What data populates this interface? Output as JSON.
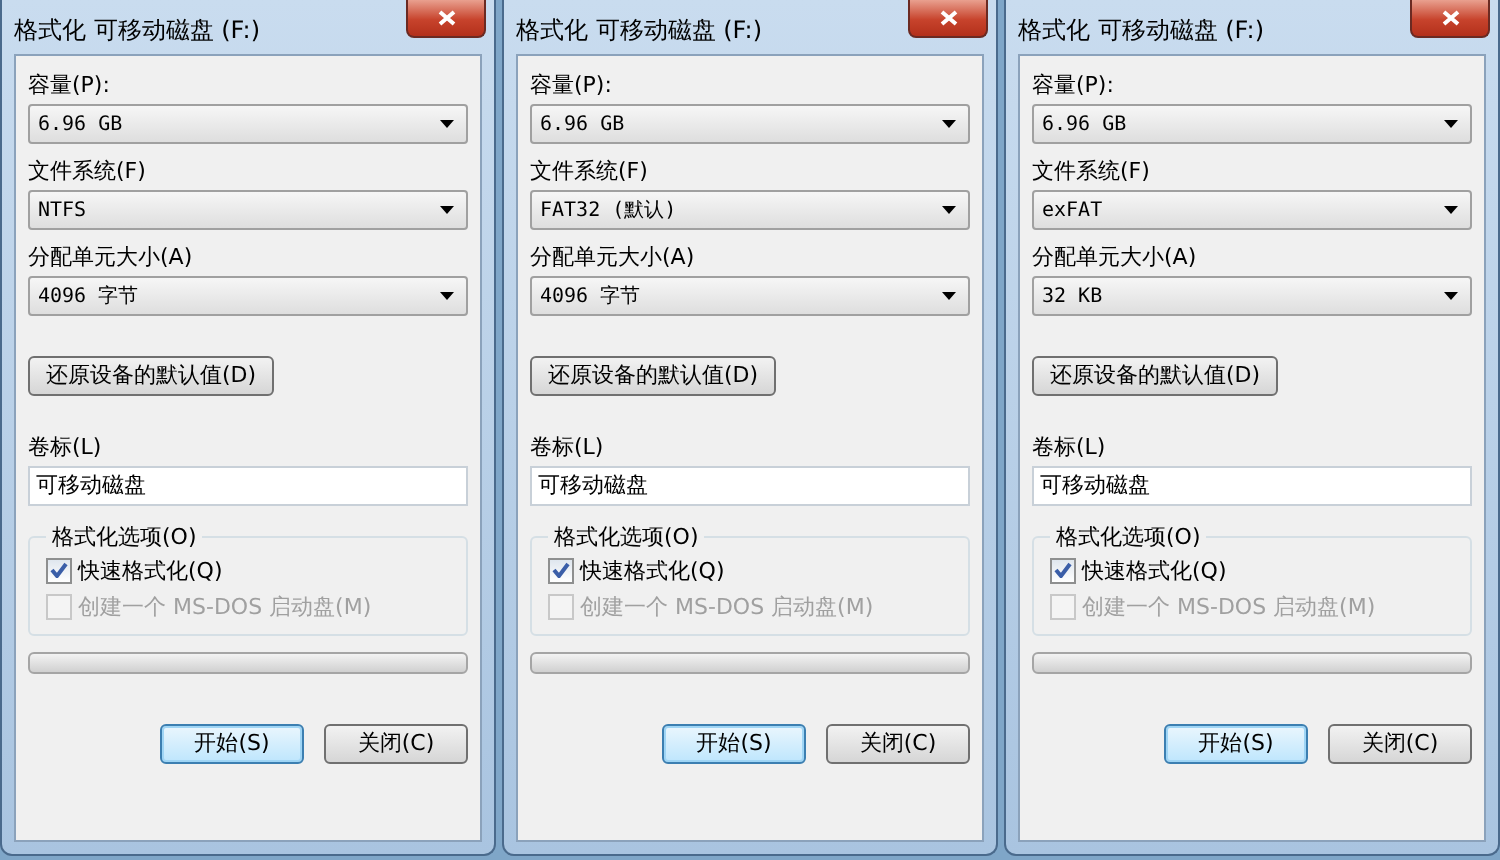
{
  "dialogs": [
    {
      "title": "格式化 可移动磁盘 (F:)",
      "capacity_label": "容量(P):",
      "capacity": "6.96 GB",
      "filesystem_label": "文件系统(F)",
      "filesystem": "NTFS",
      "allocation_label": "分配单元大小(A)",
      "allocation": "4096 字节",
      "restore_button": "还原设备的默认值(D)",
      "volume_label_label": "卷标(L)",
      "volume_label": "可移动磁盘",
      "options_title": "格式化选项(O)",
      "options": [
        {
          "label": "快速格式化(Q)",
          "checked": true,
          "disabled": false
        },
        {
          "label": "创建一个 MS-DOS 启动盘(M)",
          "checked": false,
          "disabled": true
        }
      ],
      "progress": {
        "level": 0
      },
      "buttons": [
        {
          "label": "开始(S)",
          "focused": true
        },
        {
          "label": "关闭(C)",
          "focused": false
        }
      ]
    },
    {
      "title": "格式化 可移动磁盘 (F:)",
      "capacity_label": "容量(P):",
      "capacity": "6.96 GB",
      "filesystem_label": "文件系统(F)",
      "filesystem": "FAT32 (默认)",
      "allocation_label": "分配单元大小(A)",
      "allocation": "4096 字节",
      "restore_button": "还原设备的默认值(D)",
      "volume_label_label": "卷标(L)",
      "volume_label": "可移动磁盘",
      "options_title": "格式化选项(O)",
      "options": [
        {
          "label": "快速格式化(Q)",
          "checked": true,
          "disabled": false
        },
        {
          "label": "创建一个 MS-DOS 启动盘(M)",
          "checked": false,
          "disabled": true
        }
      ],
      "progress": {
        "level": 0
      },
      "buttons": [
        {
          "label": "开始(S)",
          "focused": true
        },
        {
          "label": "关闭(C)",
          "focused": false
        }
      ]
    },
    {
      "title": "格式化 可移动磁盘 (F:)",
      "capacity_label": "容量(P):",
      "capacity": "6.96 GB",
      "filesystem_label": "文件系统(F)",
      "filesystem": "exFAT",
      "allocation_label": "分配单元大小(A)",
      "allocation": "32 KB",
      "restore_button": "还原设备的默认值(D)",
      "volume_label_label": "卷标(L)",
      "volume_label": "可移动磁盘",
      "options_title": "格式化选项(O)",
      "options": [
        {
          "label": "快速格式化(Q)",
          "checked": true,
          "disabled": false
        },
        {
          "label": "创建一个 MS-DOS 启动盘(M)",
          "checked": false,
          "disabled": true
        }
      ],
      "progress": {
        "level": 0
      },
      "buttons": [
        {
          "label": "开始(S)",
          "focused": true
        },
        {
          "label": "关闭(C)",
          "focused": false
        }
      ]
    }
  ]
}
